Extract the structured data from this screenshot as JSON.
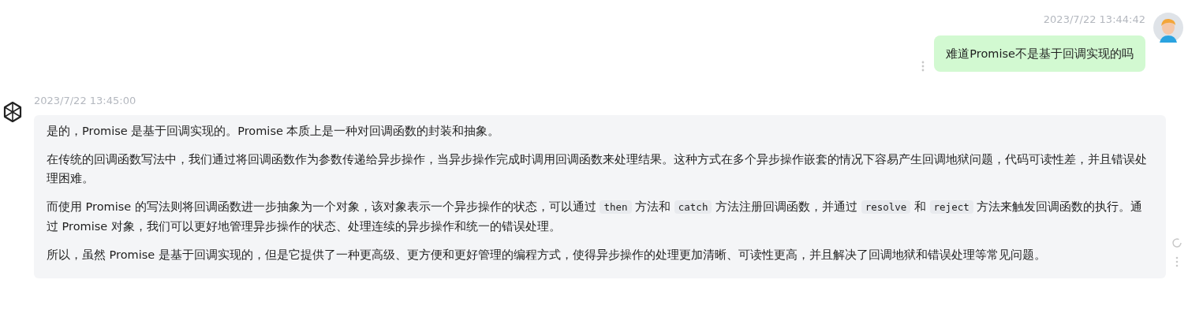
{
  "user_message": {
    "time": "2023/7/22 13:44:42",
    "text": "难道Promise不是基于回调实现的吗"
  },
  "assistant_message": {
    "time": "2023/7/22 13:45:00",
    "paragraphs": [
      [
        {
          "kind": "text",
          "text": "是的，Promise 是基于回调实现的。Promise 本质上是一种对回调函数的封装和抽象。"
        }
      ],
      [
        {
          "kind": "text",
          "text": "在传统的回调函数写法中，我们通过将回调函数作为参数传递给异步操作，当异步操作完成时调用回调函数来处理结果。这种方式在多个异步操作嵌套的情况下容易产生回调地狱问题，代码可读性差，并且错误处理困难。"
        }
      ],
      [
        {
          "kind": "text",
          "text": "而使用 Promise 的写法则将回调函数进一步抽象为一个对象，该对象表示一个异步操作的状态，可以通过 "
        },
        {
          "kind": "code",
          "text": "then"
        },
        {
          "kind": "text",
          "text": " 方法和 "
        },
        {
          "kind": "code",
          "text": "catch"
        },
        {
          "kind": "text",
          "text": " 方法注册回调函数，并通过 "
        },
        {
          "kind": "code",
          "text": "resolve"
        },
        {
          "kind": "text",
          "text": " 和 "
        },
        {
          "kind": "code",
          "text": "reject"
        },
        {
          "kind": "text",
          "text": " 方法来触发回调函数的执行。通过 Promise 对象，我们可以更好地管理异步操作的状态、处理连续的异步操作和统一的错误处理。"
        }
      ],
      [
        {
          "kind": "text",
          "text": "所以，虽然 Promise 是基于回调实现的，但是它提供了一种更高级、更方便和更好管理的编程方式，使得异步操作的处理更加清晰、可读性更高，并且解决了回调地狱和错误处理等常见问题。"
        }
      ]
    ]
  }
}
